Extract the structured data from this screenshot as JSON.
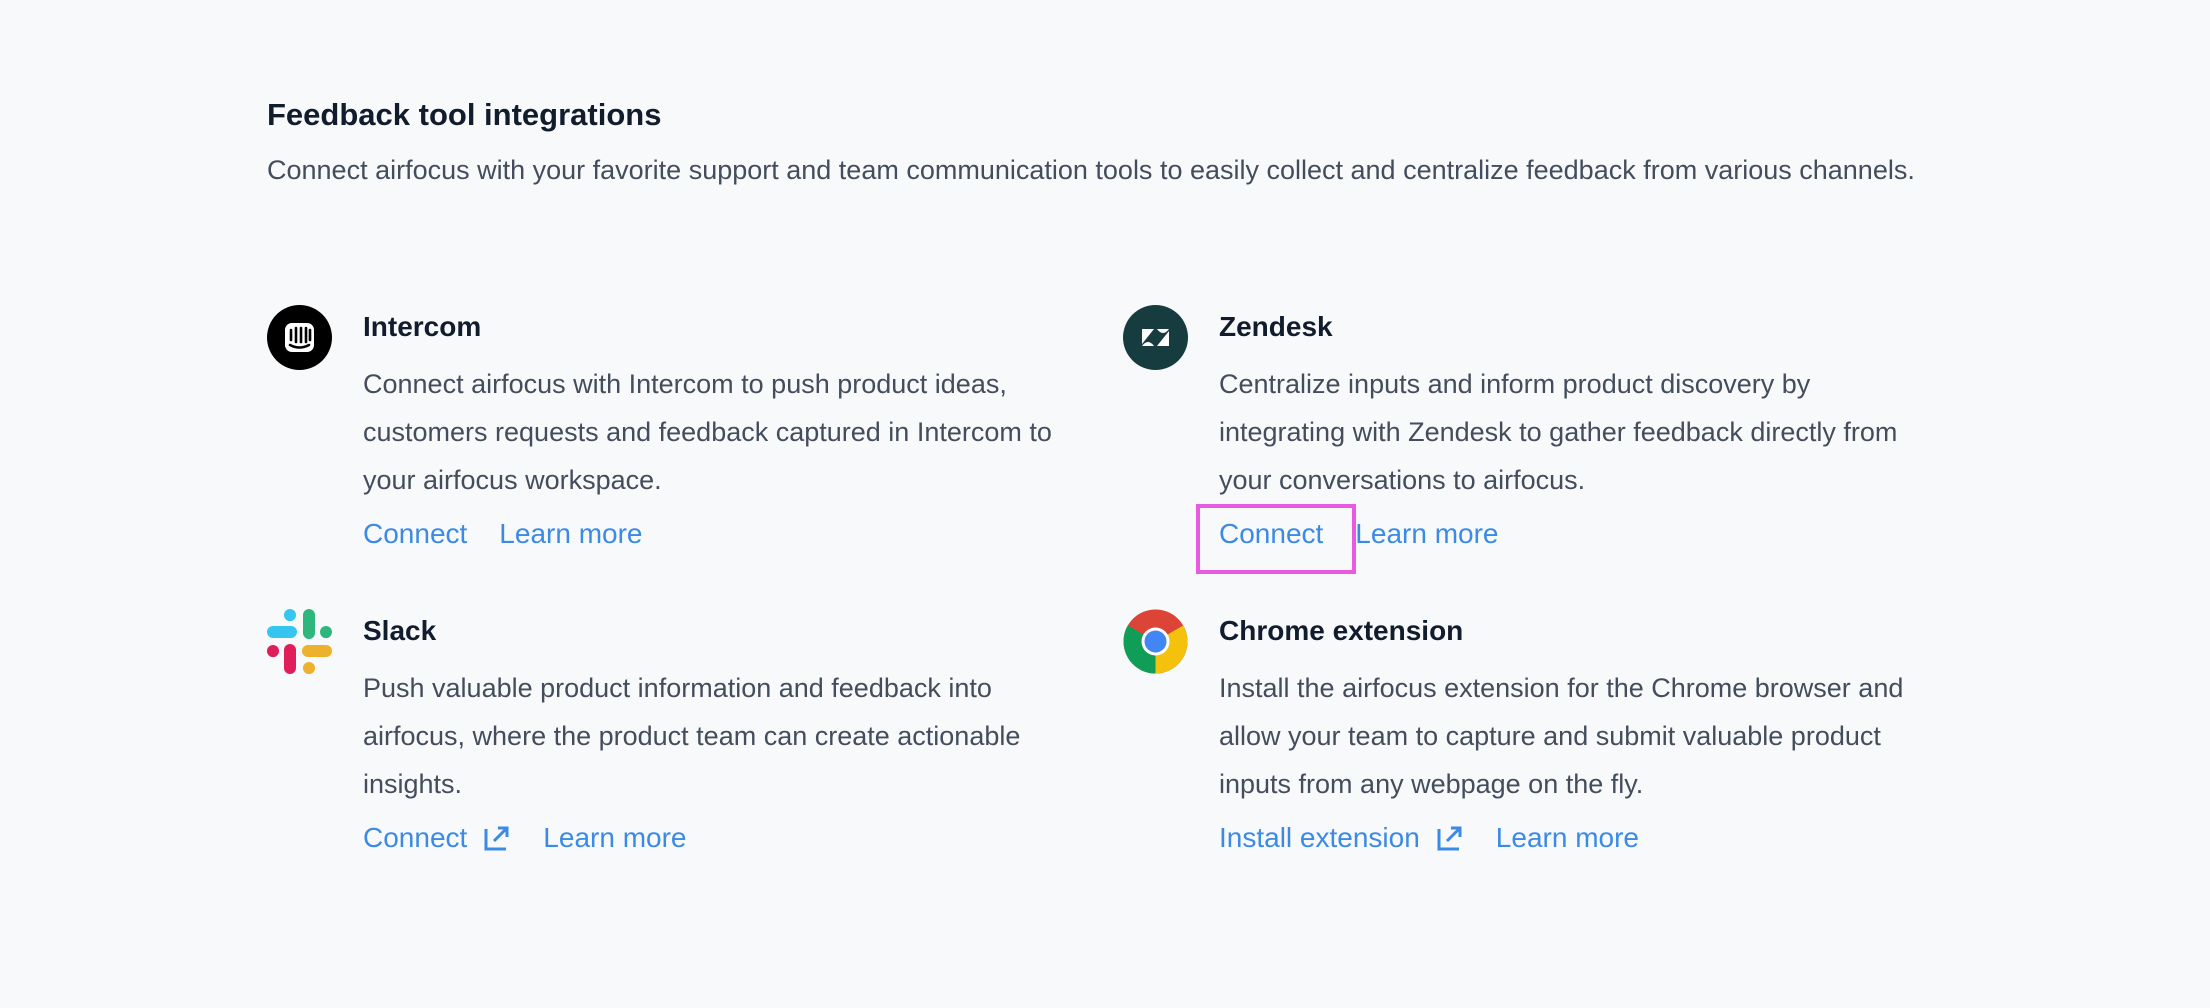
{
  "header": {
    "title": "Feedback tool integrations",
    "subtitle": "Connect airfocus with your favorite support and team communication tools to easily collect and centralize feedback from various channels."
  },
  "integrations": [
    {
      "name": "Intercom",
      "icon": "intercom-icon",
      "description": "Connect airfocus with Intercom to push product ideas, customers requests and feedback captured in Intercom to your airfocus workspace.",
      "primary_action": "Connect",
      "secondary_action": "Learn more"
    },
    {
      "name": "Zendesk",
      "icon": "zendesk-icon",
      "description": "Centralize inputs and inform product discovery by integrating with Zendesk to gather feedback directly from your conversations to airfocus.",
      "primary_action": "Connect",
      "secondary_action": "Learn more"
    },
    {
      "name": "Slack",
      "icon": "slack-icon",
      "description": "Push valuable product information and feedback into airfocus, where the product team can create actionable insights.",
      "primary_action": "Connect",
      "secondary_action": "Learn more"
    },
    {
      "name": "Chrome extension",
      "icon": "chrome-icon",
      "description": "Install the airfocus extension for the Chrome browser and allow your team to capture and submit valuable product inputs from any webpage on the fly.",
      "primary_action": "Install extension",
      "secondary_action": "Learn more"
    }
  ],
  "colors": {
    "background": "#f8f9fb",
    "link": "#3b8ae6",
    "highlight": "#e85be0"
  }
}
